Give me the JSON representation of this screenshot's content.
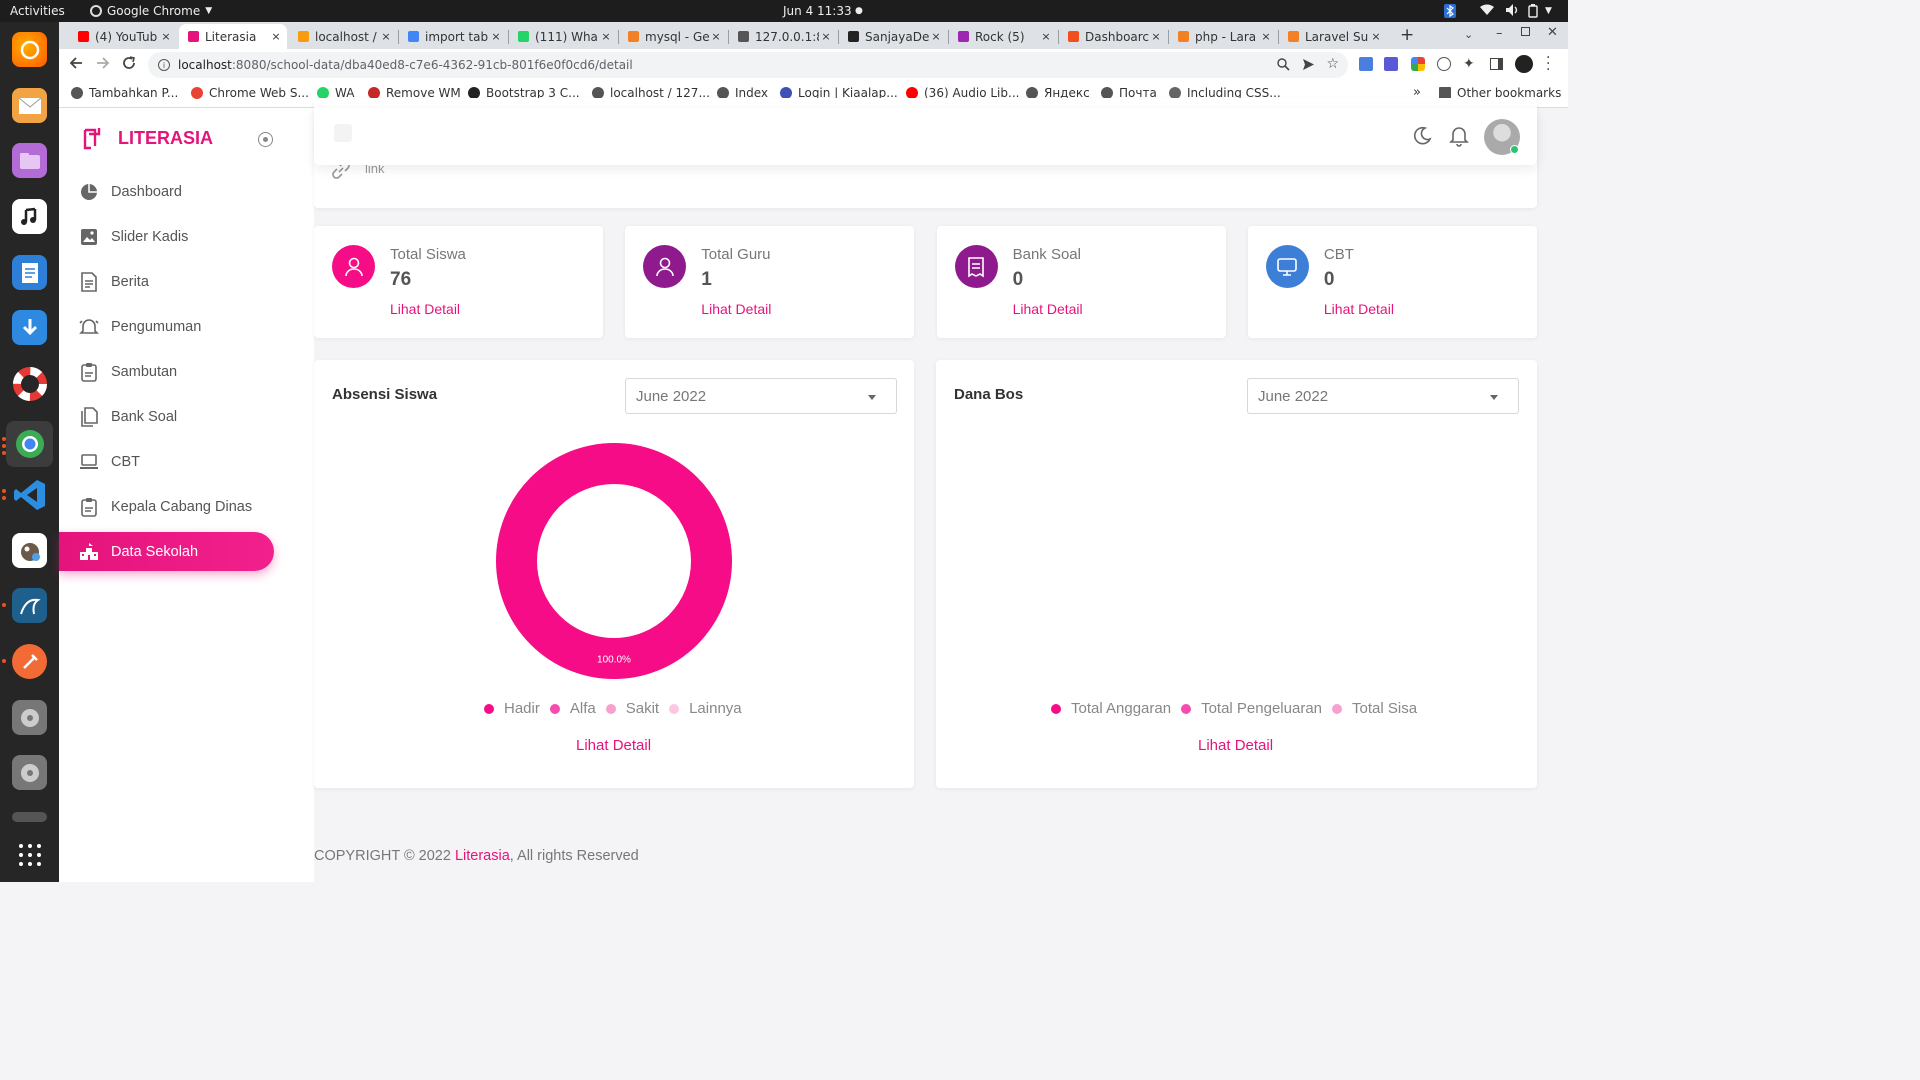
{
  "os": {
    "activities": "Activities",
    "app_menu": "Google Chrome",
    "clock": "Jun 4  11:33"
  },
  "browser": {
    "tabs": [
      {
        "title": "(4) YouTub",
        "icon_color": "#ff0000"
      },
      {
        "title": "Literasia",
        "icon_color": "#e4147c"
      },
      {
        "title": "localhost /",
        "icon_color": "#f89c0e"
      },
      {
        "title": "import tab",
        "icon_color": "#4285f4"
      },
      {
        "title": "(111) Wha",
        "icon_color": "#25d366"
      },
      {
        "title": "mysql - Ge",
        "icon_color": "#f48024"
      },
      {
        "title": "127.0.0.1:8",
        "icon_color": "#555555"
      },
      {
        "title": "SanjayaDe",
        "icon_color": "#222222"
      },
      {
        "title": "Rock (5)",
        "icon_color": "#9c27b0"
      },
      {
        "title": "Dashboarc",
        "icon_color": "#f24e1e"
      },
      {
        "title": "php - Lara",
        "icon_color": "#f48024"
      },
      {
        "title": "Laravel Su",
        "icon_color": "#f48024"
      }
    ],
    "close_label": "×",
    "new_tab": "+",
    "url_host": "localhost",
    "url_rest": ":8080/school-data/dba40ed8-c7e6-4362-91cb-801f6e0f0cd6/detail",
    "bookmarks": [
      {
        "label": "Tambahkan P...",
        "color": "#555555"
      },
      {
        "label": "Chrome Web S...",
        "color": "#ea4335"
      },
      {
        "label": "WA",
        "color": "#25d366"
      },
      {
        "label": "Remove WM",
        "color": "#c62828"
      },
      {
        "label": "Bootstrap 3 C...",
        "color": "#222222"
      },
      {
        "label": "localhost / 127...",
        "color": "#555555"
      },
      {
        "label": "Index",
        "color": "#555555"
      },
      {
        "label": "Login | Kiaalap...",
        "color": "#3f51b5"
      },
      {
        "label": "(36) Audio Lib...",
        "color": "#ff0000"
      },
      {
        "label": "Яндекс",
        "color": "#555555"
      },
      {
        "label": "Почта",
        "color": "#555555"
      },
      {
        "label": "Including CSS...",
        "color": "#666666"
      }
    ],
    "bookmarks_more": "»",
    "other_bookmarks": "Other bookmarks"
  },
  "app": {
    "brand": "LITERASIA",
    "nav": [
      {
        "label": "Dashboard",
        "icon": "pie-chart-icon"
      },
      {
        "label": "Slider Kadis",
        "icon": "image-icon"
      },
      {
        "label": "Berita",
        "icon": "document-icon"
      },
      {
        "label": "Pengumuman",
        "icon": "bell-icon"
      },
      {
        "label": "Sambutan",
        "icon": "clipboard-icon"
      },
      {
        "label": "Bank Soal",
        "icon": "files-icon"
      },
      {
        "label": "CBT",
        "icon": "laptop-icon"
      },
      {
        "label": "Kepala Cabang Dinas",
        "icon": "clipboard-icon"
      },
      {
        "label": "Data Sekolah",
        "icon": "school-icon",
        "active": true
      }
    ],
    "header_link": "link"
  },
  "stats": [
    {
      "label": "Total Siswa",
      "value": "76",
      "link": "Lihat Detail",
      "color": "#f50c86",
      "icon": "user-icon"
    },
    {
      "label": "Total Guru",
      "value": "1",
      "link": "Lihat Detail",
      "color": "#8e1a8e",
      "icon": "user-icon"
    },
    {
      "label": "Bank Soal",
      "value": "0",
      "link": "Lihat Detail",
      "color": "#8e1a8e",
      "icon": "receipt-icon"
    },
    {
      "label": "CBT",
      "value": "0",
      "link": "Lihat Detail",
      "color": "#3d7fd6",
      "icon": "monitor-icon"
    }
  ],
  "absensi": {
    "title": "Absensi Siswa",
    "period": "June 2022",
    "link": "Lihat Detail",
    "chart_data": {
      "type": "pie",
      "categories": [
        "Hadir",
        "Alfa",
        "Sakit",
        "Lainnya"
      ],
      "values": [
        100,
        0,
        0,
        0
      ],
      "slice_labels": [
        "100.0%"
      ],
      "colors": [
        "#f50c86",
        "#f54cb0",
        "#f8a0cf",
        "#fbc7e3"
      ],
      "legend_position": "bottom"
    }
  },
  "dana": {
    "title": "Dana Bos",
    "period": "June 2022",
    "link": "Lihat Detail",
    "chart_data": {
      "type": "pie",
      "categories": [
        "Total Anggaran",
        "Total Pengeluaran",
        "Total Sisa"
      ],
      "values": [],
      "colors": [
        "#f50c86",
        "#f54cb0",
        "#f8a0cf"
      ],
      "legend_position": "bottom"
    }
  },
  "footer": {
    "prefix": "COPYRIGHT © 2022 ",
    "brand": "Literasia",
    "suffix": ", All rights Reserved"
  }
}
